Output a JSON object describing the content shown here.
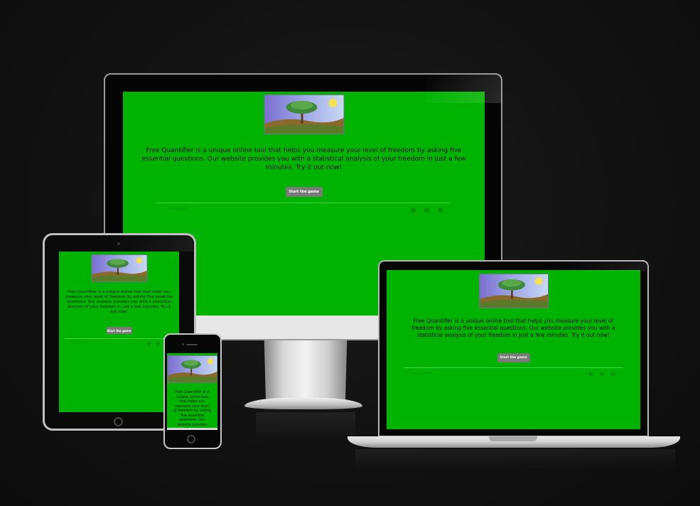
{
  "site": {
    "intro": "Free Quantifier is a unique online tool that helps you measure your level of freedom by asking five essential questions. Our website provides you with a statistical analysis of your freedom in just a few minutes. Try it out now!",
    "start_label": "Start the game",
    "footer_text": "Free Quantifier",
    "social_icons": [
      "twitter-icon",
      "instagram-icon",
      "facebook-icon"
    ]
  },
  "colors": {
    "page_background": "#00b300",
    "button": "#7a7a7a",
    "device_frame": "#050505"
  }
}
